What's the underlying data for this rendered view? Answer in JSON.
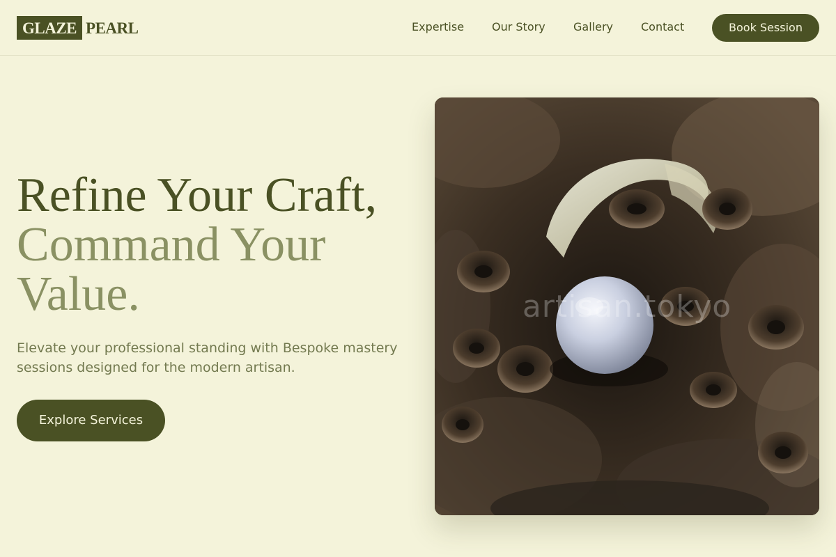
{
  "brand": {
    "logo_box_text": "GLAZE",
    "logo_text": "PEARL"
  },
  "nav": {
    "items": [
      {
        "label": "Expertise"
      },
      {
        "label": "Our Story"
      },
      {
        "label": "Gallery"
      },
      {
        "label": "Contact"
      }
    ],
    "cta_label": "Book Session"
  },
  "hero": {
    "headline_line1": "Refine Your Craft,",
    "headline_line2": "Command Your Value.",
    "subtitle": "Elevate your professional standing with Bespoke mastery sessions designed for the modern artisan.",
    "cta_label": "Explore Services",
    "image": {
      "subject": "pearl in oyster shell",
      "watermark": "artisan.tokyo"
    }
  },
  "colors": {
    "background": "#f4f3da",
    "primary": "#4a5124",
    "accent_text": "#8a9163",
    "button_text": "#f4f3da"
  }
}
